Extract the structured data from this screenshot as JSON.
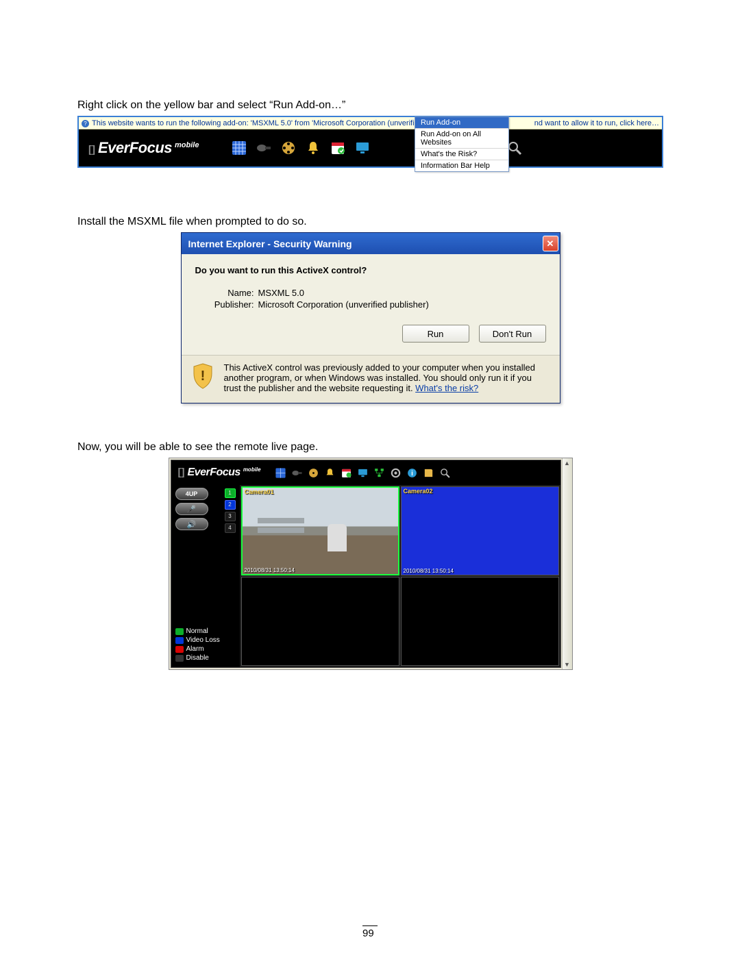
{
  "page_number": "99",
  "instructions": {
    "line1": "Right click on the yellow bar and select “Run Add-on…”",
    "line2": "Install the MSXML file when prompted to do so.",
    "line3": "Now, you will be able to see the remote live page."
  },
  "infobar": {
    "left_text": "This website wants to run the following add-on: 'MSXML 5.0' from 'Microsoft Corporation (unverified publisher)'. If y",
    "right_text": "nd want to allow it to run, click here…"
  },
  "context_menu": {
    "items": [
      "Run Add-on",
      "Run Add-on on All Websites",
      "What's the Risk?",
      "Information Bar Help"
    ]
  },
  "brand": {
    "name": "EverFocus",
    "sup": "mobile"
  },
  "toolbar_icons": [
    "grid-icon",
    "camera-icon",
    "film-icon",
    "bell-icon",
    "calendar-icon",
    "monitor-icon",
    "note-icon",
    "search-icon"
  ],
  "dialog": {
    "title": "Internet Explorer - Security Warning",
    "question": "Do you want to run this ActiveX control?",
    "name_label": "Name:",
    "name_value": "MSXML 5.0",
    "pub_label": "Publisher:",
    "pub_value": "Microsoft Corporation (unverified publisher)",
    "run": "Run",
    "dont_run": "Don't Run",
    "footer_text": "This ActiveX control was previously added to your computer when you installed another program, or when Windows was installed. You should only run it if you trust the publisher and the website requesting it.  ",
    "risk_link": "What's the risk?"
  },
  "live": {
    "toolbar_icons": [
      "grid-icon",
      "camera-icon",
      "film-icon",
      "bell-icon",
      "calendar-icon",
      "monitor-icon",
      "network-icon",
      "gear-icon",
      "info-icon",
      "note-icon",
      "search-icon"
    ],
    "four_up": "4UP",
    "cam_buttons": [
      "1",
      "2",
      "3",
      "4"
    ],
    "legend": {
      "normal": "Normal",
      "video_loss": "Video Loss",
      "alarm": "Alarm",
      "disable": "Disable"
    },
    "cameras": [
      {
        "label": "Camera01",
        "ts": "2010/08/31  13:50:14"
      },
      {
        "label": "Camera02",
        "ts": "2010/08/31  13:50:14"
      }
    ]
  }
}
